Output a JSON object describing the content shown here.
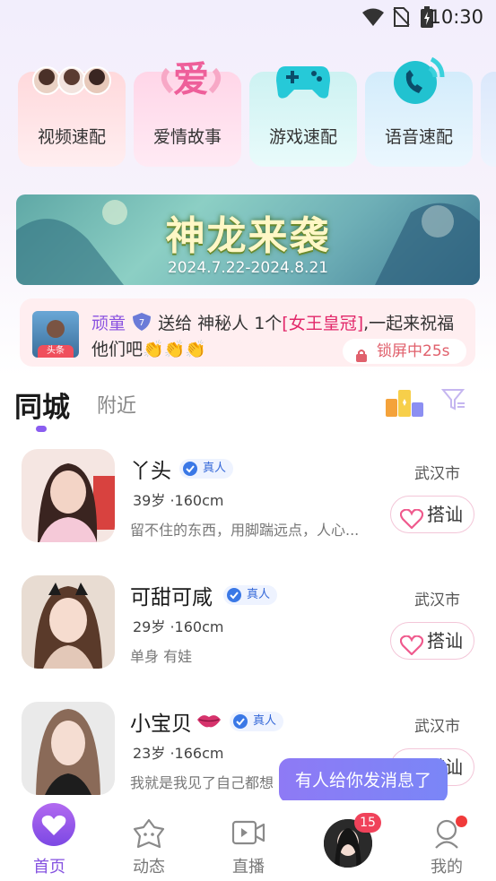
{
  "status_bar": {
    "time": "10:30"
  },
  "categories": [
    {
      "label": "视频速配"
    },
    {
      "label": "爱情故事",
      "art_text": "爱"
    },
    {
      "label": "游戏速配"
    },
    {
      "label": "语音速配"
    }
  ],
  "banner": {
    "title": "神龙来袭",
    "date": "2024.7.22-2024.8.21"
  },
  "notice": {
    "avatar_badge": "头条",
    "sender": "顽童",
    "level": "7",
    "text_before": "送给 神秘人 1个",
    "gift": "[女王皇冠]",
    "text_after": ",一起来祝福",
    "line2": "他们吧👏👏👏",
    "lock_text": "锁屏中25s"
  },
  "tabs": {
    "city": "同城",
    "nearby": "附近"
  },
  "users": [
    {
      "name": "丫头",
      "verified": "真人",
      "meta": "39岁 ·160cm",
      "desc": "留不住的东西，用脚踹远点，人心...",
      "city": "武汉市",
      "action": "搭讪"
    },
    {
      "name": "可甜可咸",
      "verified": "真人",
      "meta": "29岁 ·160cm",
      "desc": "单身   有娃",
      "city": "武汉市",
      "action": "搭讪"
    },
    {
      "name": "小宝贝",
      "verified": "真人",
      "meta": "23岁 ·166cm",
      "desc": "我就是我见了自己都想",
      "city": "武汉市",
      "action": "搭讪"
    }
  ],
  "toast": "有人给你发消息了",
  "nav": {
    "home": "首页",
    "moments": "动态",
    "live": "直播",
    "unread": "15",
    "mine": "我的"
  },
  "colors": {
    "accent": "#8552e0",
    "pink": "#e2286a",
    "badge": "#f0425a"
  }
}
